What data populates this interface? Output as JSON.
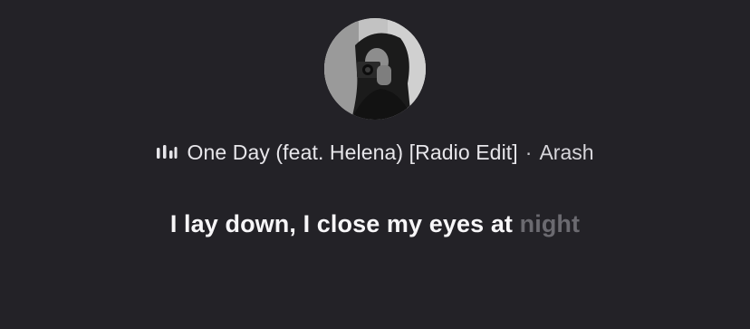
{
  "colors": {
    "background": "#232227",
    "sung": "#f7f6f8",
    "upcoming": "#6b6a70"
  },
  "avatar": {
    "icon": "artist-photo"
  },
  "now_playing": {
    "icon": "equalizer-icon",
    "title": "One Day (feat. Helena) [Radio Edit]",
    "separator": "·",
    "artist": "Arash"
  },
  "lyric": {
    "sung": "I lay down, I close my eyes at ",
    "upcoming": "night"
  }
}
